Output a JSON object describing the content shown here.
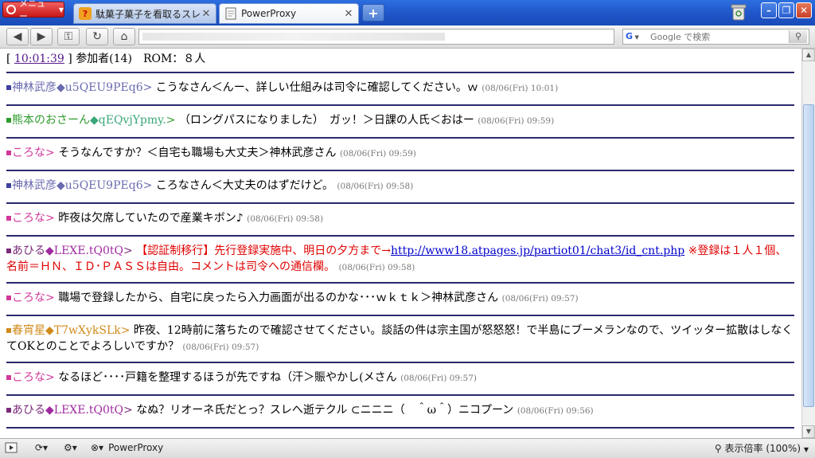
{
  "browser": {
    "menu_label": "メニュー",
    "tabs": [
      {
        "title": "駄菓子菓子を看取るスレ5",
        "active": false
      },
      {
        "title": "PowerProxy",
        "active": true
      }
    ],
    "search_placeholder": "Google で検索",
    "search_engine": "G",
    "status_proxy": "PowerProxy",
    "zoom_label": "表示倍率 (100%)"
  },
  "chat": {
    "time": "10:01:39",
    "participants": "参加者(14)",
    "rom": "ROM：８人",
    "messages": [
      {
        "name": "神林武彦",
        "trip": "◆u5QEU9PEq6",
        "color": "#6a6ab0",
        "tripcolor": "#6a6ab0",
        "sq": "#4040a0",
        "body": "こうなさん＜んー、詳しい仕組みは司令に確認してください。ｗ",
        "meta": "(08/06(Fri) 10:01)"
      },
      {
        "name": "熊本のおさーん",
        "trip": "◆qEQvjYpmy.",
        "color": "#2e9b2e",
        "tripcolor": "#3aa77a",
        "sq": "#2e9b2e",
        "body": "（ロングパスになりました）　ガッ！＞日課の人氏＜おはー",
        "meta": "(08/06(Fri) 09:59)"
      },
      {
        "name": "ころな",
        "trip": "",
        "color": "#d0389a",
        "tripcolor": "#d0389a",
        "sq": "#d0389a",
        "body": "そうなんですか？＜自宅も職場も大丈夫＞神林武彦さん",
        "meta": "(08/06(Fri) 09:59)"
      },
      {
        "name": "神林武彦",
        "trip": "◆u5QEU9PEq6",
        "color": "#6a6ab0",
        "tripcolor": "#6a6ab0",
        "sq": "#4040a0",
        "body": "ころなさん＜大丈夫のはずだけど。",
        "meta": "(08/06(Fri) 09:58)"
      },
      {
        "name": "ころな",
        "trip": "",
        "color": "#d0389a",
        "tripcolor": "#d0389a",
        "sq": "#d0389a",
        "body": "昨夜は欠席していたので産業キボン♪",
        "meta": "(08/06(Fri) 09:58)"
      },
      {
        "name": "あひる",
        "trip": "◆LEXE.tQ0tQ",
        "color": "#7a2a7a",
        "tripcolor": "#a02aa0",
        "sq": "#7a2a7a",
        "body_red1": "【認証制移行】先行登録実施中、明日の夕方まで→",
        "link": "http://www18.atpages.jp/partiot01/chat3/id_cnt.php",
        "body_red2": "※登録は１人１個、名前＝ＨＮ、ＩＤ･ＰＡＳＳは自由。コメントは司令への通信欄。",
        "meta": "(08/06(Fri) 09:58)"
      },
      {
        "name": "ころな",
        "trip": "",
        "color": "#d0389a",
        "tripcolor": "#d0389a",
        "sq": "#d0389a",
        "body": "職場で登録したから、自宅に戻ったら入力画面が出るのかな･･･ｗｋｔｋ＞神林武彦さん",
        "meta": "(08/06(Fri) 09:57)"
      },
      {
        "name": "春宵星",
        "trip": "◆T7wXykSLk",
        "color": "#d08a1a",
        "tripcolor": "#d08a1a",
        "sq": "#d08a1a",
        "body": "昨夜、12時前に落ちたので確認させてください。談話の件は宗主国が怒怒怒！で半島にブーメランなので、ツイッター拡散はしなくてOKとのことでよろしいですか？",
        "meta": "(08/06(Fri) 09:57)"
      },
      {
        "name": "ころな",
        "trip": "",
        "color": "#d0389a",
        "tripcolor": "#d0389a",
        "sq": "#d0389a",
        "body": "なるほど････戸籍を整理するほうが先ですね（汗＞賑やかし(メさん",
        "meta": "(08/06(Fri) 09:57)"
      },
      {
        "name": "あひる",
        "trip": "◆LEXE.tQ0tQ",
        "color": "#7a2a7a",
        "tripcolor": "#a02aa0",
        "sq": "#7a2a7a",
        "body": "なぬ？リオーネ氏だとっ？スレへ逝テクル ⊂ニニニ（　＾ω＾）ニコプーン",
        "meta": "(08/06(Fri) 09:56)"
      }
    ]
  }
}
